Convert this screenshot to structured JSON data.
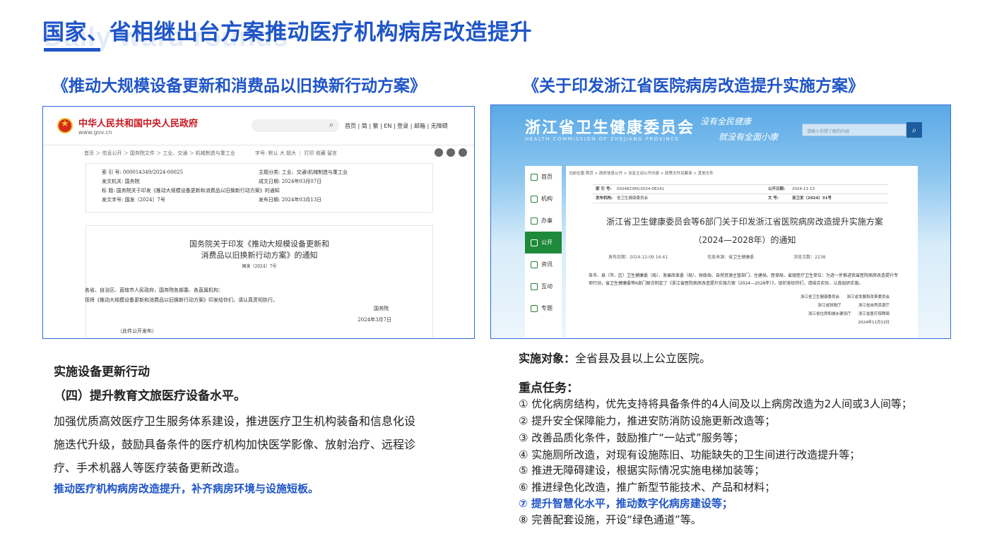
{
  "title": "国家、省相继出台方案推动医疗机构病房改造提升",
  "title_watermark": "Daily ward rounds",
  "left": {
    "heading": "《推动大规模设备更新和消费品以旧换新行动方案》",
    "gov": {
      "site_name": "中华人民共和国中央人民政府",
      "site_url": "www.gov.cn",
      "links": "首页 | 简 | 繁 | EN | 登录 | 邮箱 | 无障碍",
      "crumb": "首页 ＞ 信息公开 ＞ 国务院文件 ＞ 工业、交通 ＞ 机械制造与重工业",
      "crumb_tools": "字号: 默认 大 超大 ｜ 打印 收藏 留言",
      "meta": [
        {
          "l": "索  引  号:  000014349/2024-00025",
          "r": "主题分类:  工业、交通\\机械制造与重工业"
        },
        {
          "l": "发文机关:  国务院",
          "r": "成文日期:  2024年03月07日"
        },
        {
          "l": "标      题:  国务院关于印发《推动大规模设备更新和消费品以旧换新行动方案》的通知",
          "r": ""
        },
        {
          "l": "发文字号:  国发〔2024〕7号",
          "r": "发布日期:  2024年03月13日"
        }
      ],
      "doc_title_1": "国务院关于印发《推动大规模设备更新和",
      "doc_title_2": "消费品以旧换新行动方案》的通知",
      "doc_no": "国发〔2024〕7号",
      "body_1": "各省、自治区、直辖市人民政府，国务院各部委、各直属机构：",
      "body_2": "      现将《推动大规模设备更新和消费品以旧换新行动方案》印发给你们，请认真贯彻执行。",
      "sign": "国务院",
      "sign_date": "2024年3月7日",
      "foot": "（此件公开发布）"
    },
    "section_title": "实施设备更新行动",
    "sub_title": "（四）提升教育文旅医疗设备水平。",
    "para_1": "加强优质高效医疗卫生服务体系建设，推进医疗卫生机构装备和信息化设",
    "para_2": "施迭代升级，鼓励具备条件的医疗机构加快医学影像、放射治疗、远程诊",
    "para_3": "疗、手术机器人等医疗装备更新改造。",
    "highlight": "推动医疗机构病房改造提升，补齐病房环境与设施短板。"
  },
  "right": {
    "heading": "《关于印发浙江省医院病房改造提升实施方案》",
    "zj": {
      "site_name": "浙江省卫生健康委员会",
      "site_en": "HEALTH COMMISSION OF ZHEJIANG PROVINCE",
      "slogan_1": "没有全民健康",
      "slogan_2": "就没有全面小康",
      "search_placeholder": "请输入你想了解的内容",
      "nav": [
        "首页",
        "机构",
        "办事",
        "公开",
        "资讯",
        "互动",
        "专题"
      ],
      "crumb": "当前位置:首页 > 政府信息公开 > 法定主动公开内容 > 政策文件及解读 > 其他文件",
      "meta": [
        {
          "k1": "索 引 号:",
          "v1": "002482365/2024-08141",
          "k2": "公开日期:",
          "v2": "2024-11-13"
        },
        {
          "k1": "发布机构:",
          "v1": "省卫生健康委员会",
          "k2": "文    号:",
          "v2": "浙卫发〔2024〕31号"
        }
      ],
      "doc_title": "浙江省卫生健康委员会等6部门关于印发浙江省医院病房改造提升实施方案（2024—2028年）的通知",
      "info_date": "发布日期：2024-12-09 16:41",
      "info_source": "信息来源：省卫生健康委",
      "info_views": "浏览次数：2238",
      "body": "各市、县（市、区）卫生健康委（局）、发展改革委（局）、财政局、自然资源主管部门、住建局、医保局，省级医疗卫生单位：为进一步推进我省医院病房改造提升专项行动，省卫生健康委等6部门联合制定了《浙江省医院病房改造提升实施方案（2024—2028年）》，现印发给你们，请结合实际，认真组织实施。",
      "sign": "浙江省卫生健康委员会      浙江省发展和改革委员会\n浙江省财政厅              浙江省自然资源厅\n浙江省住房和城乡建设厅      浙江省医疗保障局\n2024年11月13日"
    },
    "target_label": "实施对象：",
    "target_text": "全省县及县以上公立医院。",
    "tasks_title": "重点任务：",
    "tasks": [
      "① 优化病房结构，优先支持将具备条件的4人间及以上病房改造为2人间或3人间等；",
      "② 提升安全保障能力，推进安防消防设施更新改造等；",
      "③ 改善品质化条件，鼓励推广“一站式”服务等；",
      "④ 实施厕所改造，对现有设施陈旧、功能缺失的卫生间进行改造提升等；",
      "⑤ 推进无障碍建设，根据实际情况实施电梯加装等；",
      "⑥ 推进绿色化改造，推广新型节能技术、产品和材料；",
      "⑦ 提升智慧化水平，推动数字化病房建设等；",
      "⑧ 完善配套设施，开设“绿色通道”等。"
    ]
  }
}
